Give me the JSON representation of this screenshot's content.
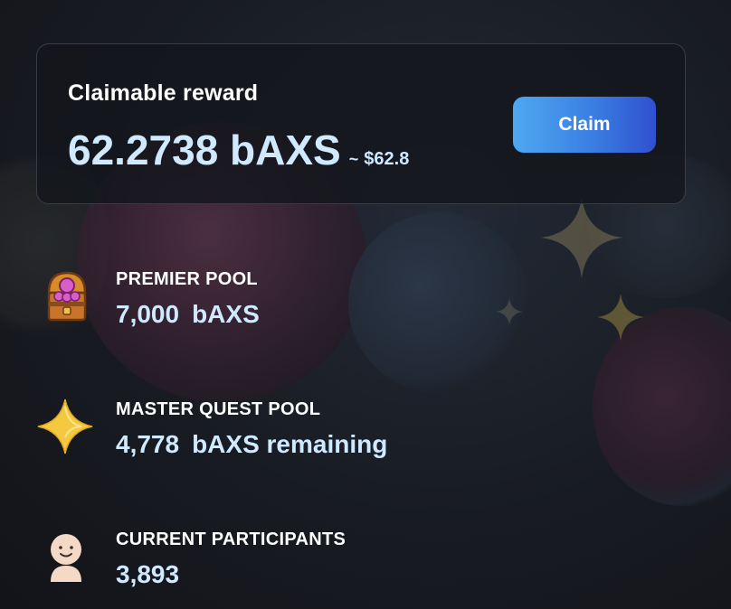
{
  "reward_card": {
    "label": "Claimable reward",
    "amount": "62.2738 bAXS",
    "approx_symbol": "~",
    "usd_value": "$62.8",
    "claim_label": "Claim"
  },
  "stats": {
    "premier_pool": {
      "title": "PREMIER POOL",
      "amount": "7,000",
      "unit": "bAXS",
      "icon": "treasure-chest-icon"
    },
    "master_quest_pool": {
      "title": "MASTER QUEST POOL",
      "amount": "4,778",
      "unit": "bAXS remaining",
      "icon": "star-icon"
    },
    "current_participants": {
      "title": "CURRENT PARTICIPANTS",
      "amount": "3,893",
      "icon": "person-icon"
    }
  },
  "colors": {
    "accent_text": "#cfe9ff",
    "button_gradient_start": "#4fa8f1",
    "button_gradient_end": "#3150d0",
    "star": "#f5c842"
  }
}
